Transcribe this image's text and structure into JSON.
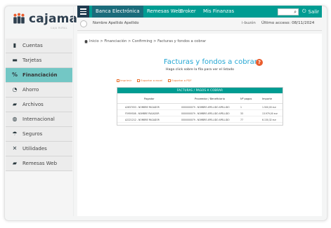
{
  "brand": {
    "name": "cajamar",
    "subline": "CAJA RURAL",
    "icon": "people-logo-icon",
    "colors": {
      "dark": "#1f3b4f",
      "teal": "#009c92",
      "accent": "#ea5d2e"
    }
  },
  "topbar": {
    "nav_items": [
      {
        "label": "Banca Electrónica",
        "active": true
      },
      {
        "label": "Remesas Web",
        "active": false
      },
      {
        "label": "Broker",
        "active": false
      },
      {
        "label": "Mis Finanzas",
        "active": false
      }
    ],
    "search_icon": "search-icon",
    "power_icon": "power-icon",
    "logout_label": "Salir"
  },
  "subbar": {
    "user_icon": "user-icon",
    "user_name": "Nombre Apellido Apellido",
    "ibuzon": "i-buzón",
    "last_access": "Último acceso: 08/11/2024"
  },
  "sidebar": {
    "items": [
      {
        "label": "Cuentas",
        "icon": "book-icon",
        "active": false
      },
      {
        "label": "Tarjetas",
        "icon": "card-icon",
        "active": false
      },
      {
        "label": "Financiación",
        "icon": "percent-icon",
        "active": true
      },
      {
        "label": "Ahorro",
        "icon": "savings-icon",
        "active": false
      },
      {
        "label": "Archivos",
        "icon": "folder-icon",
        "active": false
      },
      {
        "label": "Internacional",
        "icon": "globe-icon",
        "active": false
      },
      {
        "label": "Seguros",
        "icon": "umbrella-icon",
        "active": false
      },
      {
        "label": "Utilidades",
        "icon": "tools-icon",
        "active": false
      },
      {
        "label": "Remesas Web",
        "icon": "folder-open-icon",
        "active": false
      }
    ]
  },
  "breadcrumb": {
    "home_icon": "home-icon",
    "path": "Inicio > Financiación > Confirming > Facturas y fondos a cobrar"
  },
  "main": {
    "title": "Facturas y fondos a cobrar",
    "help_icon": "help-icon",
    "subtitle": "Haga click sobre la fila para ver el listado",
    "exports": [
      {
        "label": "Imprimir",
        "icon": "print-icon"
      },
      {
        "label": "Exportar a excel",
        "icon": "excel-icon"
      },
      {
        "label": "Exportar a PDF",
        "icon": "pdf-icon"
      }
    ],
    "table": {
      "title": "FACTURAS / PAGOS A COBRAR",
      "columns": [
        "Pagador",
        "Proveedor / Beneficiario",
        "Nº pagos",
        "Importe"
      ],
      "rows": [
        {
          "payer": "A2837053 - NOMBRE PAGADOR",
          "provider": "0000000079 - NOMBRE APELLIDO APELLIDO",
          "count": "1",
          "amount": "1.500,00 eur"
        },
        {
          "payer": "F5959308 - NOMBRE PAGADOR",
          "provider": "0000000079 - NOMBRE APELLIDO APELLIDO",
          "count": "33",
          "amount": "13.979,00 eur"
        },
        {
          "payer": "A2221212 - NOMBRE PAGADOR",
          "provider": "0000000079 - NOMBRE APELLIDO APELLIDO",
          "count": "77",
          "amount": "6.130,32 eur"
        }
      ]
    }
  }
}
